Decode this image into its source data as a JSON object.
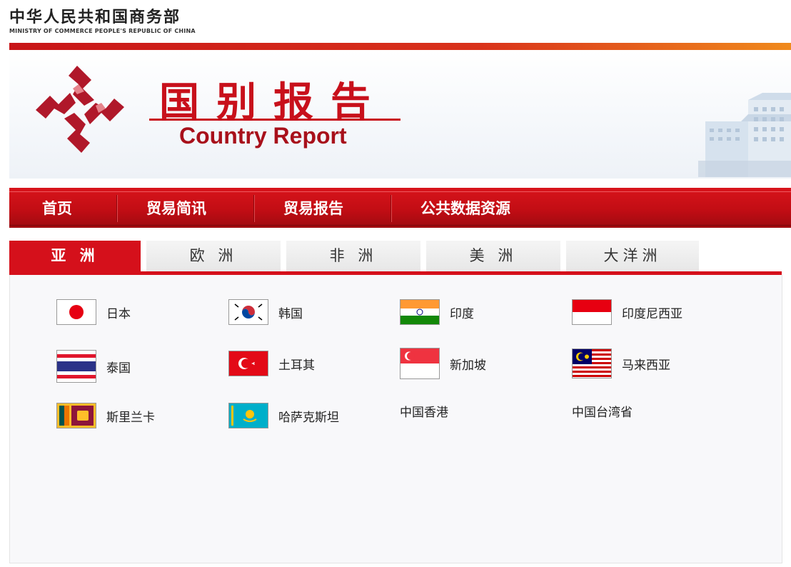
{
  "header": {
    "ministry_cn": "中华人民共和国商务部",
    "ministry_en": "MINISTRY OF COMMERCE PEOPLE'S REPUBLIC OF CHINA"
  },
  "banner": {
    "title_cn": "国别报告",
    "title_en": "Country Report"
  },
  "nav": {
    "items": [
      {
        "label": "首页"
      },
      {
        "label": "贸易简讯"
      },
      {
        "label": "贸易报告"
      },
      {
        "label": "公共数据资源"
      }
    ]
  },
  "tabs": [
    {
      "label": "亚 洲",
      "active": true
    },
    {
      "label": "欧 洲",
      "active": false
    },
    {
      "label": "非 洲",
      "active": false
    },
    {
      "label": "美 洲",
      "active": false
    },
    {
      "label": "大洋洲",
      "active": false
    }
  ],
  "countries": [
    {
      "name": "日本",
      "flag": "japan-flag"
    },
    {
      "name": "韩国",
      "flag": "south-korea-flag"
    },
    {
      "name": "印度",
      "flag": "india-flag"
    },
    {
      "name": "印度尼西亚",
      "flag": "indonesia-flag"
    },
    {
      "name": "泰国",
      "flag": "thailand-flag"
    },
    {
      "name": "土耳其",
      "flag": "turkey-flag"
    },
    {
      "name": "新加坡",
      "flag": "singapore-flag"
    },
    {
      "name": "马来西亚",
      "flag": "malaysia-flag"
    },
    {
      "name": "斯里兰卡",
      "flag": "sri-lanka-flag"
    },
    {
      "name": "哈萨克斯坦",
      "flag": "kazakhstan-flag"
    },
    {
      "name": "中国香港",
      "flag": ""
    },
    {
      "name": "中国台湾省",
      "flag": ""
    }
  ],
  "colors": {
    "accent": "#d5101b",
    "nav_bg": "#c20d14"
  }
}
